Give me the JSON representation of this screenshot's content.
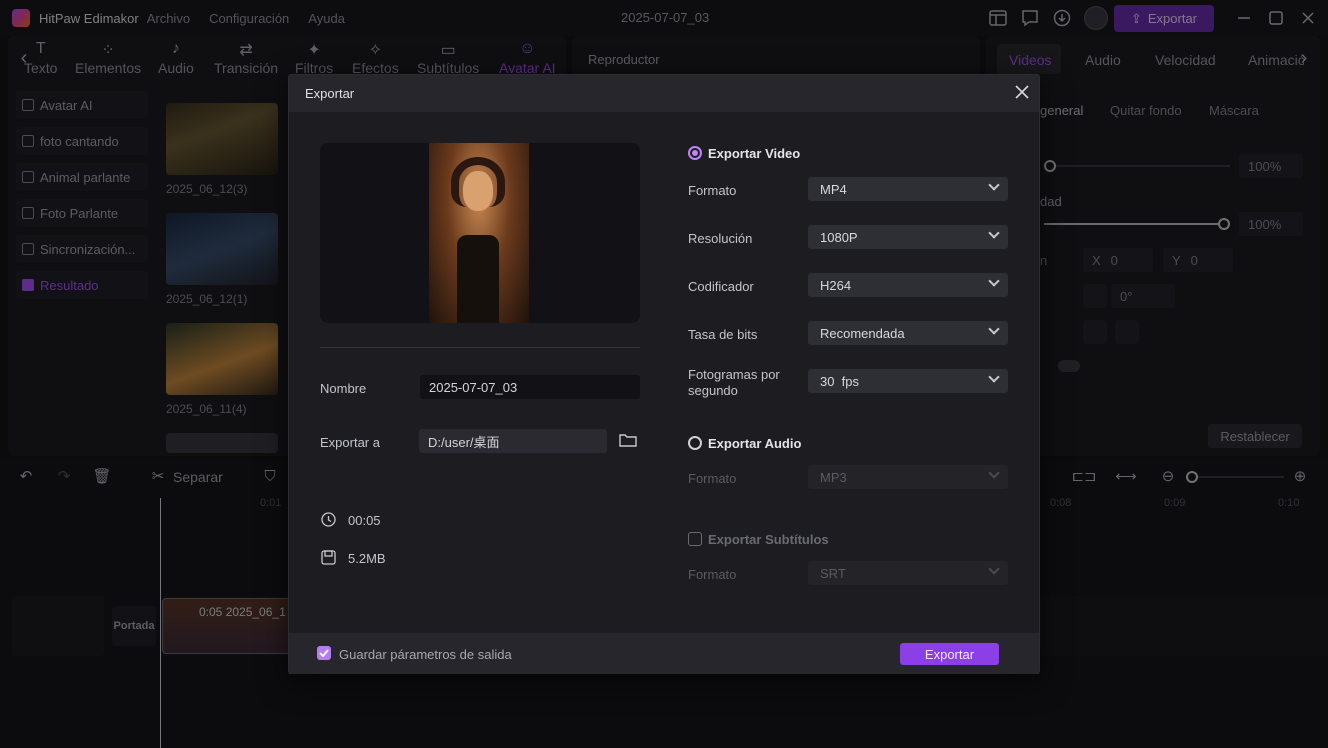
{
  "titlebar": {
    "app_name": "HitPaw Edimakor",
    "menus": [
      "Archivo",
      "Configuración",
      "Ayuda"
    ],
    "project_name": "2025-07-07_03",
    "export_label": "Exportar"
  },
  "toolbar_tabs": [
    {
      "label": "Texto"
    },
    {
      "label": "Elementos"
    },
    {
      "label": "Audio"
    },
    {
      "label": "Transición"
    },
    {
      "label": "Filtros"
    },
    {
      "label": "Efectos"
    },
    {
      "label": "Subtítulos"
    },
    {
      "label": "Avatar AI"
    }
  ],
  "sidebar": {
    "items": [
      {
        "label": "Avatar AI"
      },
      {
        "label": "foto cantando"
      },
      {
        "label": "Animal parlante"
      },
      {
        "label": "Foto Parlante"
      },
      {
        "label": "Sincronización..."
      },
      {
        "label": "Resultado"
      }
    ]
  },
  "media": {
    "captions": [
      "2025_06_12(3)",
      "2025_06_12(1)",
      "2025_06_11(4)"
    ]
  },
  "player": {
    "title": "Reproductor"
  },
  "right_panel": {
    "tabs": [
      "Videos",
      "Audio",
      "Velocidad",
      "Animación"
    ],
    "subtabs": [
      "general",
      "Quitar fondo",
      "Máscara"
    ],
    "opacity_value": "100%",
    "scale_value": "100%",
    "scale_label": "dad",
    "pos_label": "n",
    "x_label": "X",
    "x_value": "0",
    "y_label": "Y",
    "y_value": "0",
    "rotation_value": "0°",
    "reset_label": "Restablecer"
  },
  "timeline": {
    "split_label": "Separar",
    "ticks": [
      "0:01",
      "0:08",
      "0:09",
      "0:10"
    ],
    "cover_label": "Portada",
    "clip_label": "0:05 2025_06_1"
  },
  "export_dialog": {
    "title": "Exportar",
    "name_label": "Nombre",
    "name_value": "2025-07-07_03",
    "path_label": "Exportar a",
    "path_value": "D:/user/桌面",
    "duration": "00:05",
    "size": "5.2MB",
    "video_section": "Exportar Video",
    "format_label": "Formato",
    "format_value": "MP4",
    "resolution_label": "Resolución",
    "resolution_value": "1080P",
    "encoder_label": "Codificador",
    "encoder_value": "H264",
    "bitrate_label": "Tasa de bits",
    "bitrate_value": "Recomendada",
    "fps_label_1": "Fotogramas por",
    "fps_label_2": "segundo",
    "fps_value": "30  fps",
    "audio_section": "Exportar Audio",
    "audio_format_label": "Formato",
    "audio_format_value": "MP3",
    "subtitle_section": "Exportar Subtítulos",
    "subtitle_format_label": "Formato",
    "subtitle_format_value": "SRT",
    "save_params_label": "Guardar párametros de salida",
    "export_button": "Exportar",
    "video_selected": true,
    "save_params_checked": true
  },
  "colors": {
    "accent": "#a855f7",
    "export_btn": "#8b3fe6",
    "bg": "#141417"
  }
}
